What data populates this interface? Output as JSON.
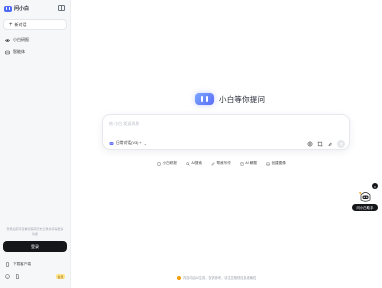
{
  "brand": {
    "name": "问小白",
    "logo_icon": "xiaobai-logo-icon"
  },
  "sidebar": {
    "new_chat_label": "新对话",
    "items": [
      {
        "label": "小白研报",
        "icon": "research-icon"
      },
      {
        "label": "智能体",
        "icon": "agent-icon"
      }
    ],
    "login_hint": "登录后即可查看和保存历史记录并获得更多功能",
    "login_label": "登录",
    "download_label": "下载客户端",
    "vip_badge": "会员"
  },
  "main": {
    "hero_title": "小白等你提问",
    "input": {
      "placeholder": "给 小白 发送消息"
    },
    "model_label": "日常对话(V3) +",
    "quick_actions": [
      {
        "label": "小白研报",
        "icon": "doc-icon"
      },
      {
        "label": "AI搜索",
        "icon": "search-icon"
      },
      {
        "label": "帮我写作",
        "icon": "pen-icon"
      },
      {
        "label": "AI 解题",
        "icon": "calculator-icon"
      },
      {
        "label": "创建图像",
        "icon": "image-icon"
      }
    ],
    "disclaimer": "内容均由AI生成，仅供参考，请注意甄别信息准确性"
  },
  "assistant": {
    "label": "问小白助手"
  },
  "colors": {
    "accent": "#5b6cf6",
    "dark": "#15161a",
    "sidebar_bg": "#f6f7f9"
  }
}
